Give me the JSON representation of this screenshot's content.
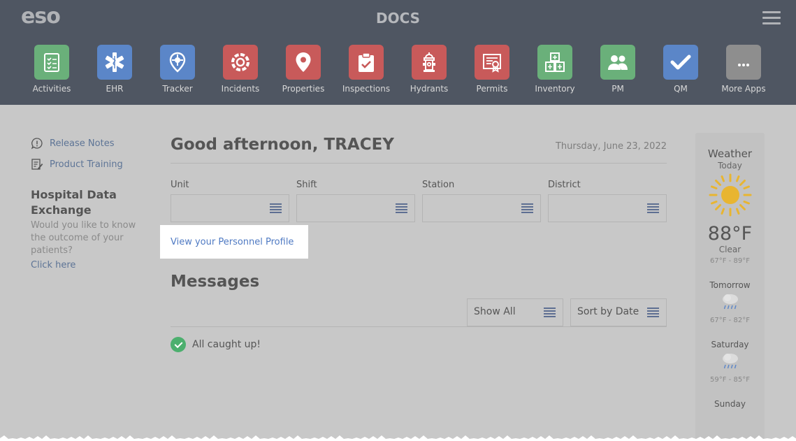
{
  "header": {
    "logo": "eso",
    "title": "DOCS",
    "menu_icon": "hamburger-menu-icon"
  },
  "apps": [
    {
      "label": "Activities",
      "icon": "checklist-icon",
      "color": "#6ab07a"
    },
    {
      "label": "EHR",
      "icon": "star-of-life-icon",
      "color": "#5b86c8"
    },
    {
      "label": "Tracker",
      "icon": "location-crosshair-icon",
      "color": "#5b86c8"
    },
    {
      "label": "Incidents",
      "icon": "fire-department-emblem-icon",
      "color": "#c85a5a"
    },
    {
      "label": "Properties",
      "icon": "map-pin-icon",
      "color": "#c85a5a"
    },
    {
      "label": "Inspections",
      "icon": "clipboard-check-icon",
      "color": "#c85a5a"
    },
    {
      "label": "Hydrants",
      "icon": "fire-hydrant-icon",
      "color": "#c85a5a"
    },
    {
      "label": "Permits",
      "icon": "certificate-icon",
      "color": "#c85a5a"
    },
    {
      "label": "Inventory",
      "icon": "boxes-icon",
      "color": "#6ab07a"
    },
    {
      "label": "PM",
      "icon": "people-icon",
      "color": "#6ab07a"
    },
    {
      "label": "QM",
      "icon": "checkmark-icon",
      "color": "#5b86c8"
    },
    {
      "label": "More Apps",
      "icon": "ellipsis-icon",
      "color": "#8e8e8e"
    }
  ],
  "sidebar": {
    "release_notes": "Release Notes",
    "product_training": "Product Training",
    "hde_title": "Hospital Data Exchange",
    "hde_text": "Would you like to know the outcome of your patients?",
    "hde_link": "Click here"
  },
  "main": {
    "greeting": "Good afternoon, TRACEY",
    "date": "Thursday, June 23, 2022",
    "fields": [
      {
        "label": "Unit",
        "value": ""
      },
      {
        "label": "Shift",
        "value": ""
      },
      {
        "label": "Station",
        "value": ""
      },
      {
        "label": "District",
        "value": ""
      }
    ],
    "profile_link": "View your Personnel Profile",
    "messages_title": "Messages",
    "show_all": "Show All",
    "sort_by": "Sort by Date",
    "caught_up": "All caught up!"
  },
  "weather": {
    "title": "Weather",
    "today_label": "Today",
    "today_icon": "sun-icon",
    "today_temp": "88°F",
    "today_condition": "Clear",
    "today_range": "67°F - 89°F",
    "forecast": [
      {
        "day": "Tomorrow",
        "icon": "rain-cloud-icon",
        "range": "67°F - 82°F"
      },
      {
        "day": "Saturday",
        "icon": "rain-cloud-icon",
        "range": "59°F - 85°F"
      },
      {
        "day": "Sunday",
        "icon": "rain-cloud-icon",
        "range": ""
      }
    ]
  },
  "colors": {
    "header_bg": "#4f5662",
    "link": "#4f7ac3",
    "success": "#4caf6e"
  }
}
